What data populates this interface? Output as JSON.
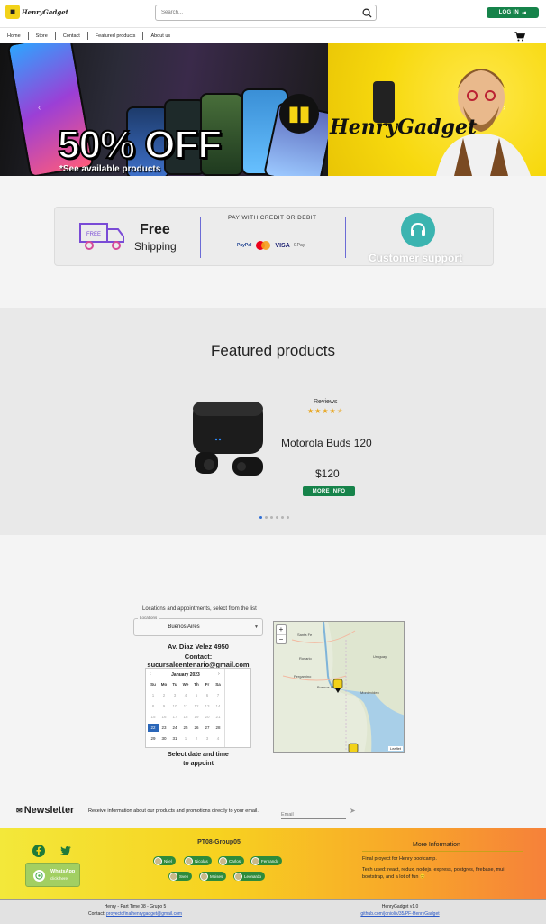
{
  "header": {
    "brand": "HenryGadget",
    "search_placeholder": "Search...",
    "login_label": "LOG IN"
  },
  "nav": {
    "items": [
      "Home",
      "Store",
      "Contact",
      "Featured products",
      "About us"
    ]
  },
  "hero": {
    "headline": "50% OFF",
    "subline": "*See available products",
    "brand": "HenryGadget"
  },
  "features": {
    "free_title": "Free",
    "free_sub": "Shipping",
    "free_badge": "FREE",
    "pay_title": "PAY WITH CREDIT OR DEBIT",
    "pay_methods": [
      "PayPal",
      "VISA",
      "GPay"
    ],
    "support": "Customer support"
  },
  "featured": {
    "title": "Featured products",
    "reviews_label": "Reviews",
    "rating": 4.5,
    "product_name": "Motorola Buds 120",
    "price": "$120",
    "more_info": "MORE INFO",
    "slides": 6,
    "active_slide": 0
  },
  "location": {
    "caption": "Locations and appointments, select from the list",
    "select_label": "Locations",
    "selected": "Buenos Aires",
    "address": "Av. Diaz Velez 4950",
    "contact": "Contact: sucursalcentenario@gmail.com",
    "appoint_line1": "Select date and time",
    "appoint_line2": "to appoint"
  },
  "calendar": {
    "month": "January 2023",
    "weekdays": [
      "Su",
      "Mo",
      "Tu",
      "We",
      "Th",
      "Fr",
      "Sa"
    ],
    "rows": [
      [
        "1",
        "2",
        "3",
        "4",
        "5",
        "6",
        "7"
      ],
      [
        "8",
        "9",
        "10",
        "11",
        "12",
        "13",
        "14"
      ],
      [
        "15",
        "16",
        "17",
        "18",
        "19",
        "20",
        "21"
      ],
      [
        "22",
        "23",
        "24",
        "25",
        "26",
        "27",
        "28"
      ],
      [
        "29",
        "30",
        "31",
        "1",
        "2",
        "3",
        "4"
      ]
    ],
    "selected_day": "22"
  },
  "map": {
    "attribution": "Leaflet",
    "labels": [
      "Santa Fe",
      "Rosario",
      "Buenos Aires",
      "Montevideo",
      "Uruguay",
      "Pergamino"
    ]
  },
  "newsletter": {
    "title": "Newsletter",
    "text": "Receive information about our products and promotions directly to your email.",
    "email_placeholder": "Email"
  },
  "footer": {
    "whatsapp_label": "WhatsApp",
    "whatsapp_sub": "click here!",
    "group_title": "PT08-Group05",
    "members": [
      "Nijel",
      "Nicolás",
      "Carlos",
      "Fernando",
      "Sven",
      "Moises",
      "Leonardo"
    ],
    "more_title": "More Information",
    "more_line1": "Final proyect for Henry bootcamp.",
    "more_line2": "Tech used: react, redux, nodejs, express, postgres, firebase, mui, bootstrap, and a lot of fun 😊",
    "bottom_left_1": "Henry - Part Time 08 - Grupo 5",
    "bottom_left_2_label": "Contact:",
    "bottom_left_2_link": "proyectofinalhenrygadget@gmail.com",
    "bottom_right_1": "HenryGadget v1.0",
    "bottom_right_2": "github.com/joniolik/35/PF-HenryGadget"
  },
  "colors": {
    "primary_green": "#16834a",
    "hero_yellow": "#f7d90f",
    "accent_blue": "#2a66b8"
  }
}
